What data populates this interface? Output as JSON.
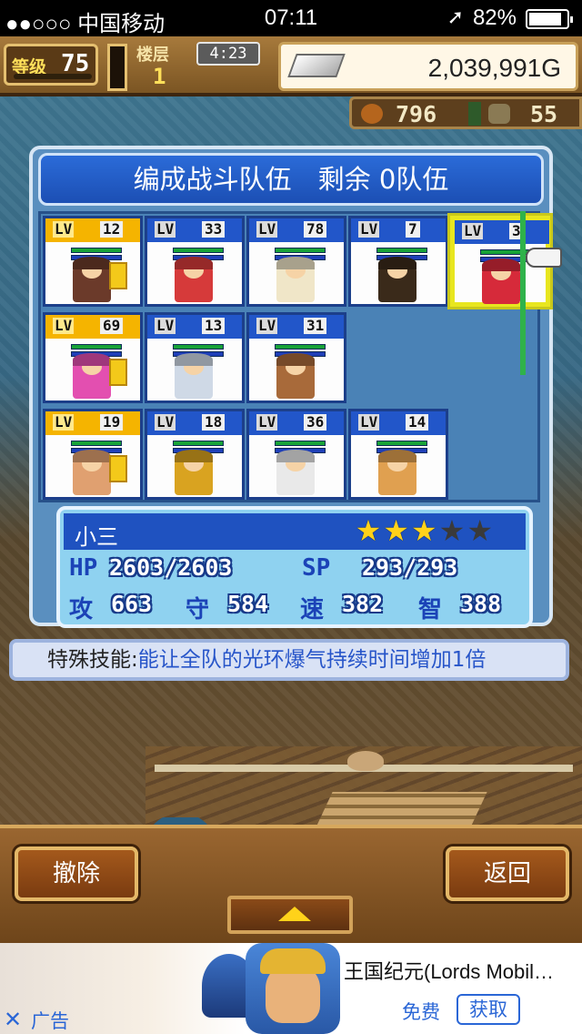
{
  "status_bar": {
    "carrier": "●●○○○ 中国移动",
    "time": "07:11",
    "battery": "82%"
  },
  "hud": {
    "rank_label": "等级",
    "rank_value": "75",
    "floor_label": "楼层",
    "floor_value": "1",
    "timer": "4:23",
    "gold": "2,039,991G",
    "meat": "796",
    "wood": "55"
  },
  "panel": {
    "title": "编成战斗队伍　剩余 0队伍",
    "lv_label": "LV",
    "rows": [
      [
        {
          "lv": "12",
          "gold": true,
          "color": "#6b3a2a"
        },
        {
          "lv": "33",
          "gold": false,
          "color": "#d63a3a"
        },
        {
          "lv": "78",
          "gold": false,
          "color": "#f0e6c8"
        },
        {
          "lv": "7",
          "gold": false,
          "color": "#3a2a1a"
        },
        {
          "lv": "3",
          "gold": false,
          "color": "#d62a3a",
          "selected": true
        }
      ],
      [
        {
          "lv": "69",
          "gold": true,
          "color": "#e34fb0"
        },
        {
          "lv": "13",
          "gold": false,
          "color": "#cfd9e6"
        },
        {
          "lv": "31",
          "gold": false,
          "color": "#a86a3a"
        }
      ],
      [
        {
          "lv": "19",
          "gold": true,
          "color": "#e0a070"
        },
        {
          "lv": "18",
          "gold": false,
          "color": "#d9a320"
        },
        {
          "lv": "36",
          "gold": false,
          "color": "#e9e9e9"
        },
        {
          "lv": "14",
          "gold": false,
          "color": "#e0a050"
        }
      ]
    ]
  },
  "character": {
    "name": "小三",
    "stars_filled": 3,
    "stars_total": 5,
    "hp_label": "HP",
    "hp": "2603/2603",
    "sp_label": "SP",
    "sp": "293/293",
    "atk_label": "攻",
    "atk": "663",
    "def_label": "守",
    "def": "584",
    "spd_label": "速",
    "spd": "382",
    "int_label": "智",
    "int": "388"
  },
  "skill": {
    "label": "特殊技能:",
    "text": "能让全队的光环爆气持续时间增加1倍"
  },
  "buttons": {
    "remove": "撤除",
    "back": "返回"
  },
  "ad": {
    "title": "王国纪元(Lords Mobil…",
    "price": "免费",
    "get": "获取",
    "label": "广告",
    "close": "✕"
  }
}
